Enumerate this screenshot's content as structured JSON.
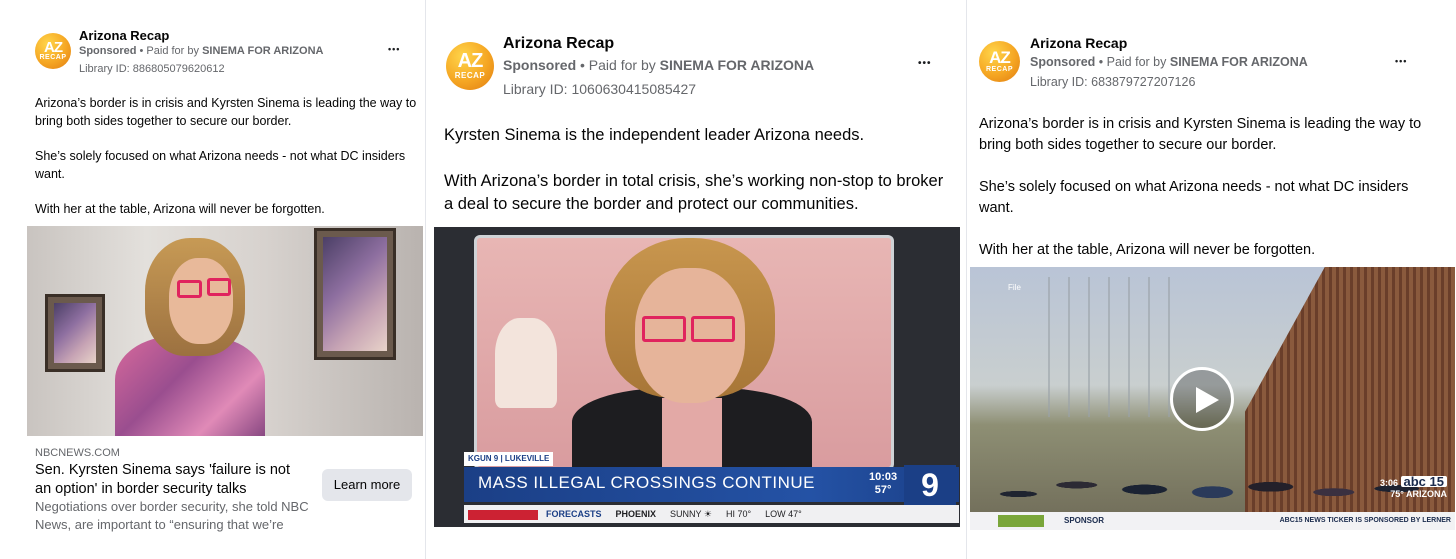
{
  "ads": [
    {
      "page_name": "Arizona Recap",
      "logo_text": "AZ",
      "logo_subtext": "RECAP",
      "sponsored": "Sponsored",
      "paid_prefix": " • Paid for by ",
      "paid_by": "SINEMA FOR ARIZONA",
      "library_id": "Library ID: 886805079620612",
      "more_label": "•••",
      "body": [
        "Arizona’s border is in crisis and Kyrsten Sinema is leading the way to bring both sides together to secure our border.",
        "She’s solely focused on what Arizona needs - not what DC insiders want.",
        "With her at the table, Arizona will never be forgotten."
      ],
      "link_domain": "NBCNEWS.COM",
      "link_title": "Sen. Kyrsten Sinema says 'failure is not an option' in border security talks",
      "link_description": "Negotiations over border security, she told NBC News, are important to “ensuring that we’re fightin…",
      "cta_label": "Learn more"
    },
    {
      "page_name": "Arizona Recap",
      "logo_text": "AZ",
      "logo_subtext": "RECAP",
      "sponsored": "Sponsored",
      "paid_prefix": " • Paid for by ",
      "paid_by": "SINEMA FOR ARIZONA",
      "library_id": "Library ID: 1060630415085427",
      "more_label": "•••",
      "body": [
        "Kyrsten Sinema is the independent leader Arizona needs.",
        "With Arizona’s border in total crisis, she’s working non-stop to broker a deal to secure the border and protect our communities."
      ],
      "video": {
        "chip": "KGUN 9 | LUKEVILLE",
        "headline": "MASS ILLEGAL CROSSINGS CONTINUE",
        "time": "10:03",
        "temp": "57°",
        "channel": "9",
        "ticker": [
          "FORECASTS",
          "PHOENIX",
          "SUNNY ☀",
          "HI 70°",
          "LOW 47°"
        ]
      }
    },
    {
      "page_name": "Arizona Recap",
      "logo_text": "AZ",
      "logo_subtext": "RECAP",
      "sponsored": "Sponsored",
      "paid_prefix": " • Paid for by ",
      "paid_by": "SINEMA FOR ARIZONA",
      "library_id": "Library ID: 683879727207126",
      "more_label": "•••",
      "body": [
        "Arizona’s border is in crisis and Kyrsten Sinema is leading the way to bring both sides together to secure our border.",
        "She’s solely focused on what Arizona needs - not what DC insiders want.",
        "With her at the table, Arizona will never be forgotten."
      ],
      "video": {
        "file_label": "File",
        "time": "3:06",
        "temp": "75°",
        "channel": "abc 15",
        "channel_sub": "ARIZONA",
        "sponsor": "SPONSOR",
        "ticker_note": "ABC15 NEWS TICKER IS SPONSORED BY LERNER"
      }
    }
  ],
  "colors": {
    "text_primary": "#050505",
    "text_secondary": "#65676b",
    "button_bg": "#e4e6eb",
    "logo_orange": "#f5a623",
    "news_blue": "#1b3f86"
  }
}
